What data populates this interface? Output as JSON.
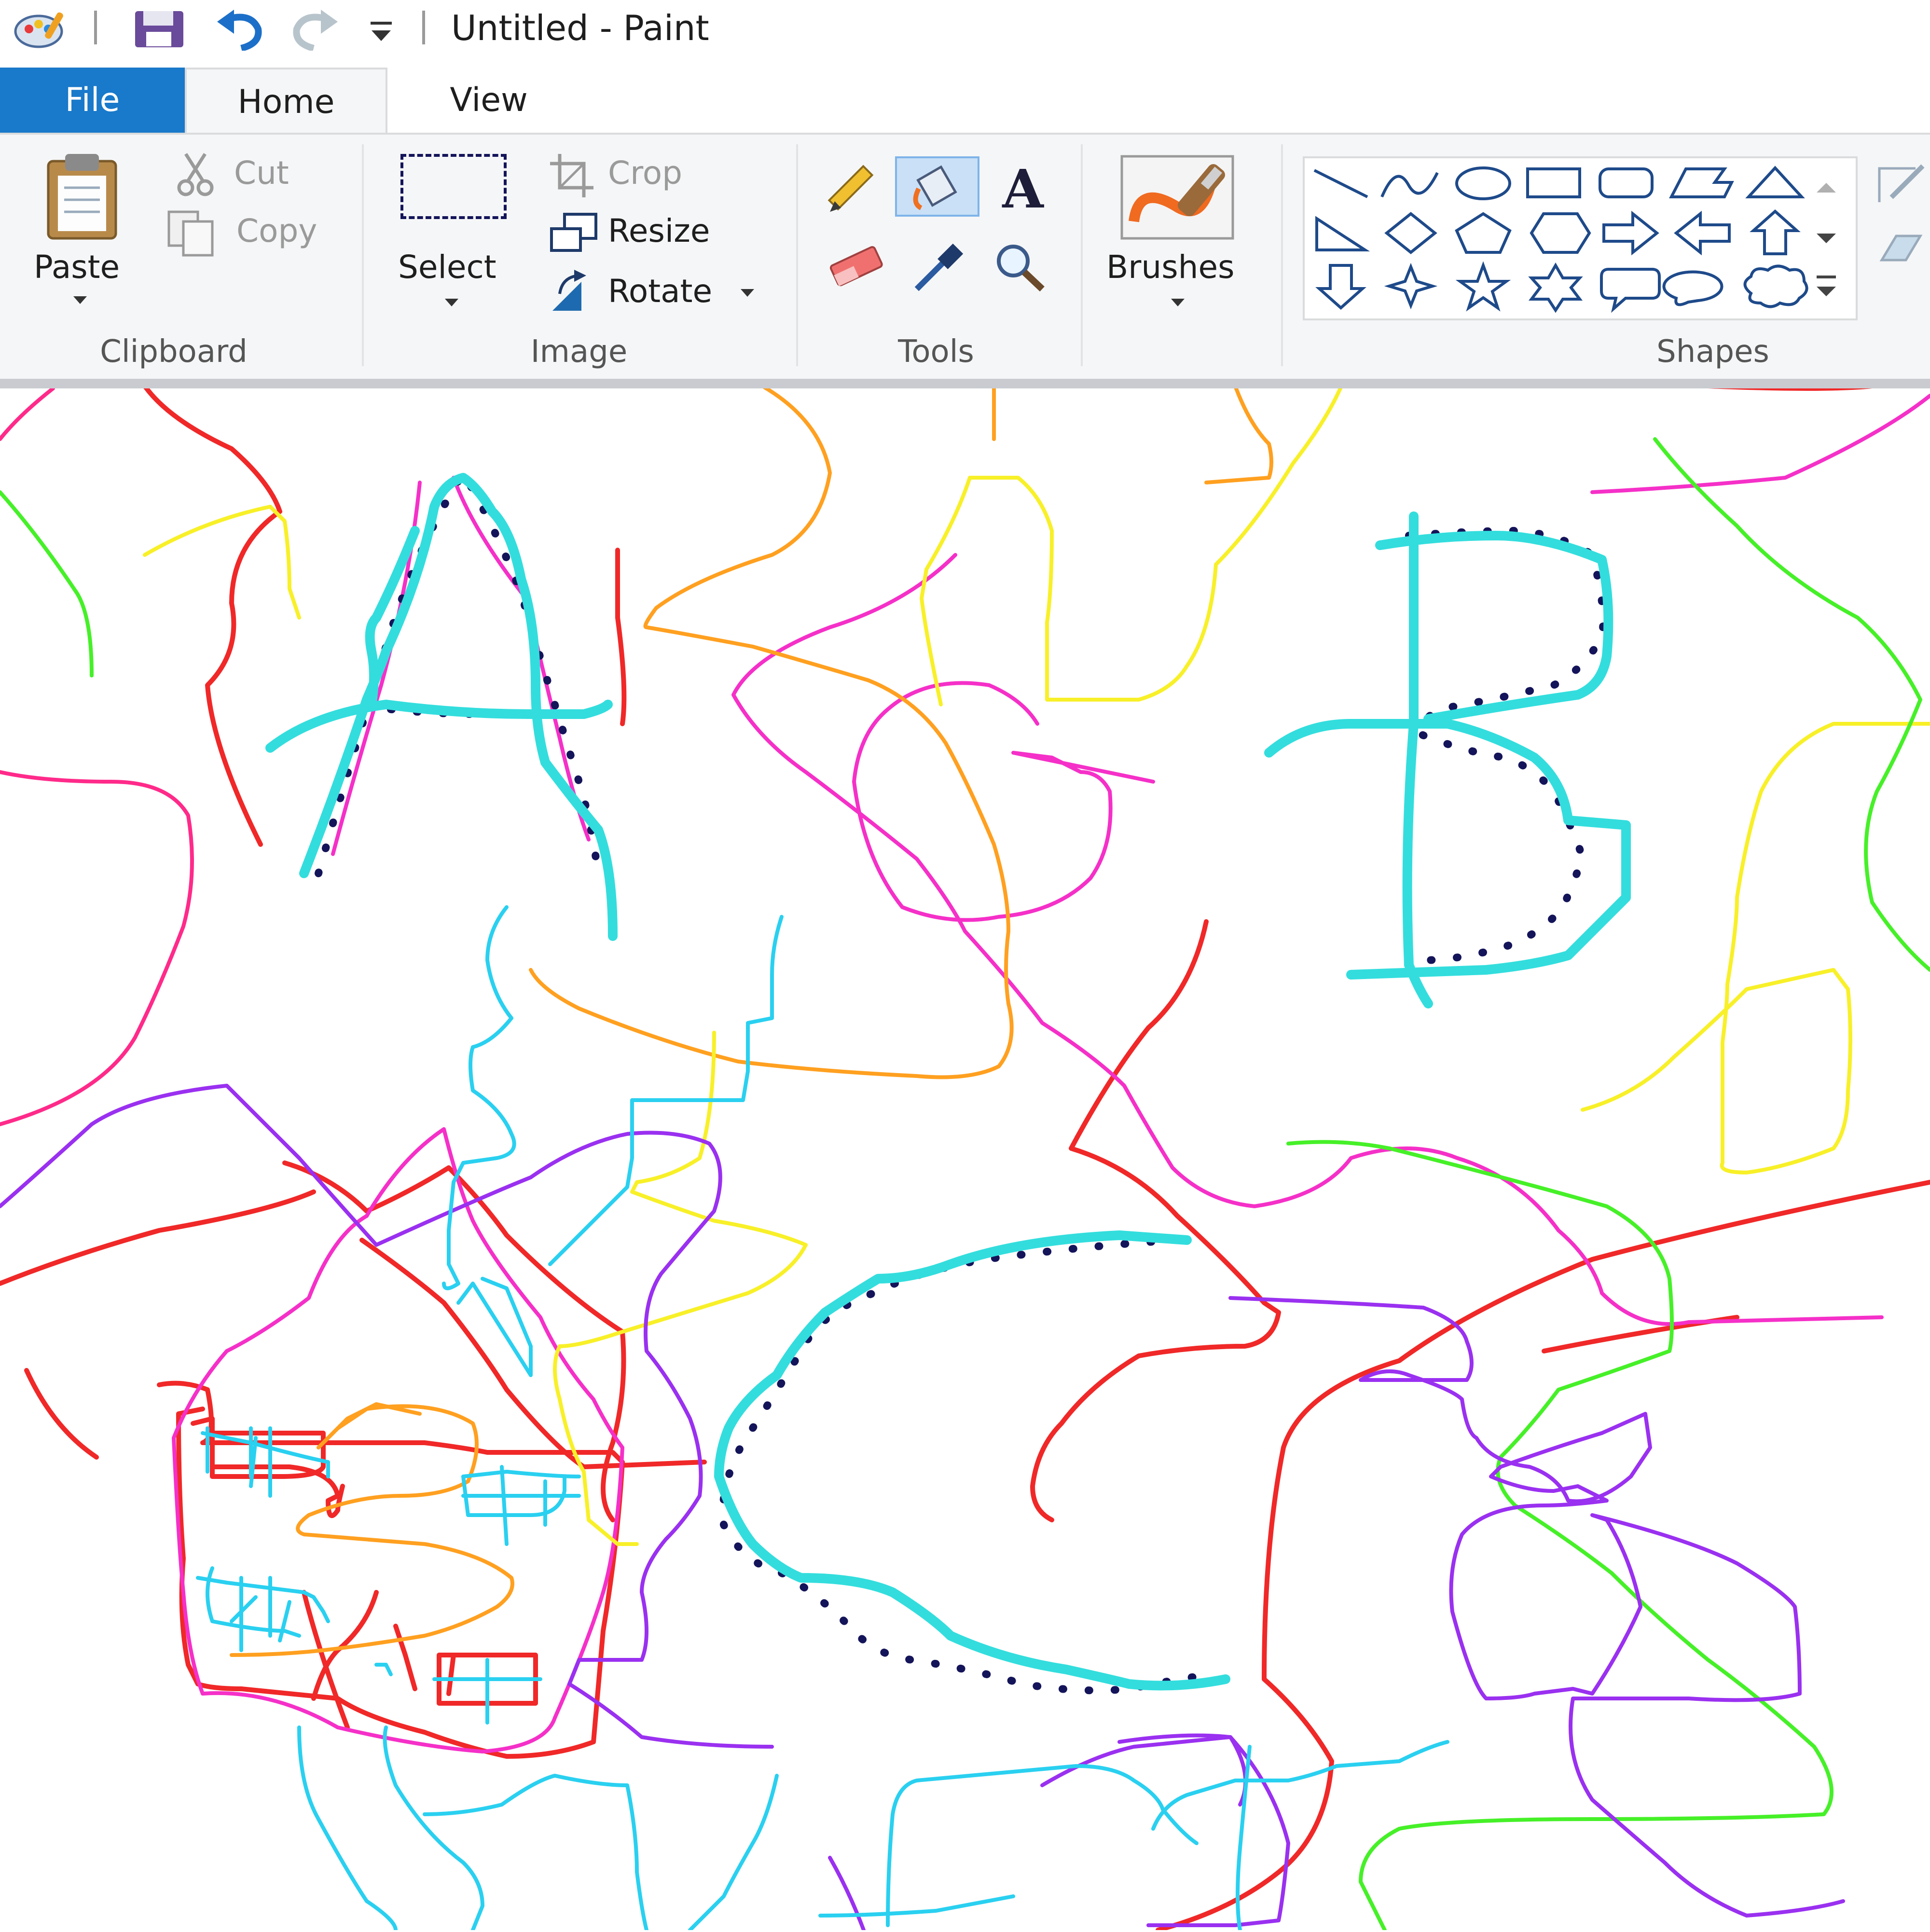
{
  "titlebar": {
    "title": "Untitled - Paint",
    "icons": [
      "paint-app-icon",
      "save-icon",
      "undo-icon",
      "redo-icon",
      "customize-quick-access-icon"
    ]
  },
  "tabs": [
    {
      "label": "File"
    },
    {
      "label": "Home"
    },
    {
      "label": "View"
    }
  ],
  "clipboard": {
    "paste_label": "Paste",
    "cut_label": "Cut",
    "copy_label": "Copy",
    "group_label": "Clipboard"
  },
  "image": {
    "select_label": "Select",
    "crop_label": "Crop",
    "resize_label": "Resize",
    "rotate_label": "Rotate",
    "group_label": "Image"
  },
  "tools": {
    "group_label": "Tools",
    "items": [
      "pencil-icon",
      "fill-icon",
      "text-icon",
      "eraser-icon",
      "color-picker-icon",
      "magnifier-icon"
    ]
  },
  "brushes": {
    "label": "Brushes"
  },
  "shapes": {
    "group_label": "Shapes",
    "items": [
      "line",
      "curve",
      "oval",
      "rectangle",
      "rounded-rectangle",
      "polygon",
      "triangle",
      "right-triangle",
      "diamond",
      "pentagon",
      "hexagon",
      "right-arrow",
      "left-arrow",
      "up-arrow",
      "down-arrow",
      "four-point-star",
      "five-point-star",
      "six-point-star",
      "rounded-callout",
      "oval-callout",
      "cloud-callout"
    ]
  },
  "canvas": {
    "stroke_colors": {
      "cyan": "#33dddd",
      "navy": "#14145a",
      "magenta": "#f530c8",
      "red": "#f02828",
      "orange": "#ffa020",
      "yellow": "#f8f028",
      "green": "#46f028",
      "purple": "#9a30f0",
      "pink": "#ff2a8a",
      "light-blue": "#2ad0f0"
    }
  }
}
